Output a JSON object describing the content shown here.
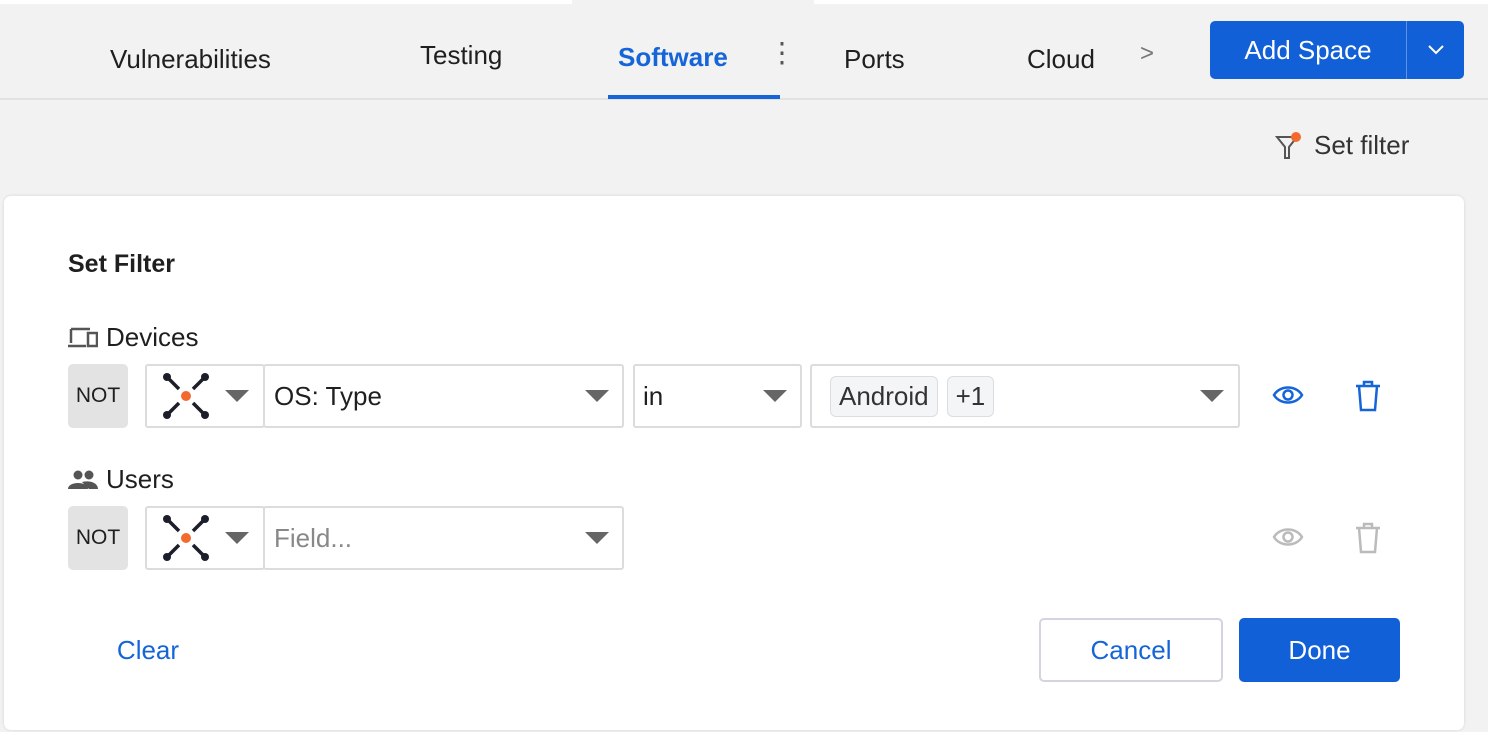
{
  "tabs": [
    {
      "label": "Vulnerabilities"
    },
    {
      "label": "Testing"
    },
    {
      "label": "Software",
      "active": true
    },
    {
      "label": "Ports"
    },
    {
      "label": "Cloud"
    }
  ],
  "header": {
    "add_space_label": "Add Space",
    "set_filter_label": "Set filter"
  },
  "filter": {
    "title": "Set Filter",
    "sections": [
      {
        "label": "Devices",
        "not_label": "NOT",
        "field_value": "OS: Type",
        "operator": "in",
        "values": [
          "Android",
          "+1"
        ]
      },
      {
        "label": "Users",
        "not_label": "NOT",
        "field_placeholder": "Field..."
      }
    ],
    "clear_label": "Clear",
    "cancel_label": "Cancel",
    "done_label": "Done"
  },
  "colors": {
    "accent": "#1160d8",
    "orange": "#f26a2e"
  }
}
